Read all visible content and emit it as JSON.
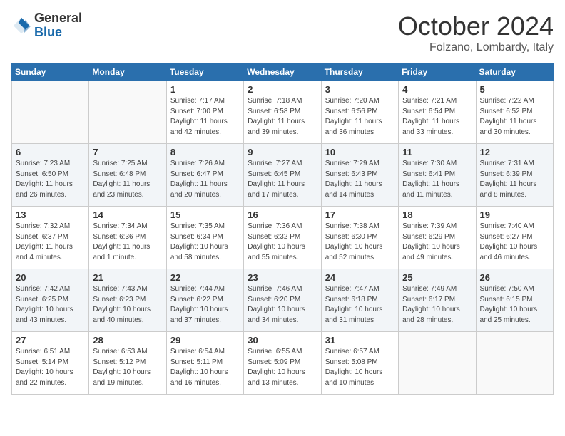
{
  "logo": {
    "general": "General",
    "blue": "Blue"
  },
  "title": "October 2024",
  "location": "Folzano, Lombardy, Italy",
  "days_of_week": [
    "Sunday",
    "Monday",
    "Tuesday",
    "Wednesday",
    "Thursday",
    "Friday",
    "Saturday"
  ],
  "weeks": [
    [
      {
        "day": "",
        "info": ""
      },
      {
        "day": "",
        "info": ""
      },
      {
        "day": "1",
        "info": "Sunrise: 7:17 AM\nSunset: 7:00 PM\nDaylight: 11 hours and 42 minutes."
      },
      {
        "day": "2",
        "info": "Sunrise: 7:18 AM\nSunset: 6:58 PM\nDaylight: 11 hours and 39 minutes."
      },
      {
        "day": "3",
        "info": "Sunrise: 7:20 AM\nSunset: 6:56 PM\nDaylight: 11 hours and 36 minutes."
      },
      {
        "day": "4",
        "info": "Sunrise: 7:21 AM\nSunset: 6:54 PM\nDaylight: 11 hours and 33 minutes."
      },
      {
        "day": "5",
        "info": "Sunrise: 7:22 AM\nSunset: 6:52 PM\nDaylight: 11 hours and 30 minutes."
      }
    ],
    [
      {
        "day": "6",
        "info": "Sunrise: 7:23 AM\nSunset: 6:50 PM\nDaylight: 11 hours and 26 minutes."
      },
      {
        "day": "7",
        "info": "Sunrise: 7:25 AM\nSunset: 6:48 PM\nDaylight: 11 hours and 23 minutes."
      },
      {
        "day": "8",
        "info": "Sunrise: 7:26 AM\nSunset: 6:47 PM\nDaylight: 11 hours and 20 minutes."
      },
      {
        "day": "9",
        "info": "Sunrise: 7:27 AM\nSunset: 6:45 PM\nDaylight: 11 hours and 17 minutes."
      },
      {
        "day": "10",
        "info": "Sunrise: 7:29 AM\nSunset: 6:43 PM\nDaylight: 11 hours and 14 minutes."
      },
      {
        "day": "11",
        "info": "Sunrise: 7:30 AM\nSunset: 6:41 PM\nDaylight: 11 hours and 11 minutes."
      },
      {
        "day": "12",
        "info": "Sunrise: 7:31 AM\nSunset: 6:39 PM\nDaylight: 11 hours and 8 minutes."
      }
    ],
    [
      {
        "day": "13",
        "info": "Sunrise: 7:32 AM\nSunset: 6:37 PM\nDaylight: 11 hours and 4 minutes."
      },
      {
        "day": "14",
        "info": "Sunrise: 7:34 AM\nSunset: 6:36 PM\nDaylight: 11 hours and 1 minute."
      },
      {
        "day": "15",
        "info": "Sunrise: 7:35 AM\nSunset: 6:34 PM\nDaylight: 10 hours and 58 minutes."
      },
      {
        "day": "16",
        "info": "Sunrise: 7:36 AM\nSunset: 6:32 PM\nDaylight: 10 hours and 55 minutes."
      },
      {
        "day": "17",
        "info": "Sunrise: 7:38 AM\nSunset: 6:30 PM\nDaylight: 10 hours and 52 minutes."
      },
      {
        "day": "18",
        "info": "Sunrise: 7:39 AM\nSunset: 6:29 PM\nDaylight: 10 hours and 49 minutes."
      },
      {
        "day": "19",
        "info": "Sunrise: 7:40 AM\nSunset: 6:27 PM\nDaylight: 10 hours and 46 minutes."
      }
    ],
    [
      {
        "day": "20",
        "info": "Sunrise: 7:42 AM\nSunset: 6:25 PM\nDaylight: 10 hours and 43 minutes."
      },
      {
        "day": "21",
        "info": "Sunrise: 7:43 AM\nSunset: 6:23 PM\nDaylight: 10 hours and 40 minutes."
      },
      {
        "day": "22",
        "info": "Sunrise: 7:44 AM\nSunset: 6:22 PM\nDaylight: 10 hours and 37 minutes."
      },
      {
        "day": "23",
        "info": "Sunrise: 7:46 AM\nSunset: 6:20 PM\nDaylight: 10 hours and 34 minutes."
      },
      {
        "day": "24",
        "info": "Sunrise: 7:47 AM\nSunset: 6:18 PM\nDaylight: 10 hours and 31 minutes."
      },
      {
        "day": "25",
        "info": "Sunrise: 7:49 AM\nSunset: 6:17 PM\nDaylight: 10 hours and 28 minutes."
      },
      {
        "day": "26",
        "info": "Sunrise: 7:50 AM\nSunset: 6:15 PM\nDaylight: 10 hours and 25 minutes."
      }
    ],
    [
      {
        "day": "27",
        "info": "Sunrise: 6:51 AM\nSunset: 5:14 PM\nDaylight: 10 hours and 22 minutes."
      },
      {
        "day": "28",
        "info": "Sunrise: 6:53 AM\nSunset: 5:12 PM\nDaylight: 10 hours and 19 minutes."
      },
      {
        "day": "29",
        "info": "Sunrise: 6:54 AM\nSunset: 5:11 PM\nDaylight: 10 hours and 16 minutes."
      },
      {
        "day": "30",
        "info": "Sunrise: 6:55 AM\nSunset: 5:09 PM\nDaylight: 10 hours and 13 minutes."
      },
      {
        "day": "31",
        "info": "Sunrise: 6:57 AM\nSunset: 5:08 PM\nDaylight: 10 hours and 10 minutes."
      },
      {
        "day": "",
        "info": ""
      },
      {
        "day": "",
        "info": ""
      }
    ]
  ]
}
